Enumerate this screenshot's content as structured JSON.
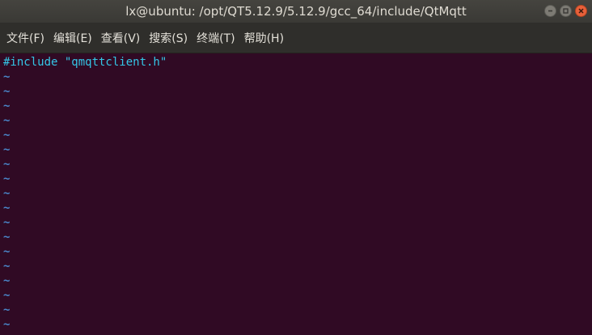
{
  "window": {
    "title": "lx@ubuntu: /opt/QT5.12.9/5.12.9/gcc_64/include/QtMqtt"
  },
  "menu": {
    "items": [
      {
        "label": "文件(F)"
      },
      {
        "label": "编辑(E)"
      },
      {
        "label": "查看(V)"
      },
      {
        "label": "搜索(S)"
      },
      {
        "label": "终端(T)"
      },
      {
        "label": "帮助(H)"
      }
    ]
  },
  "editor": {
    "lines": [
      "#include \"qmqttclient.h\""
    ],
    "empty_line_marker": "~"
  },
  "colors": {
    "terminal_background": "#300a24",
    "code_text": "#34c6e6",
    "tilde": "#4a86c9",
    "close_button": "#e8603a"
  }
}
